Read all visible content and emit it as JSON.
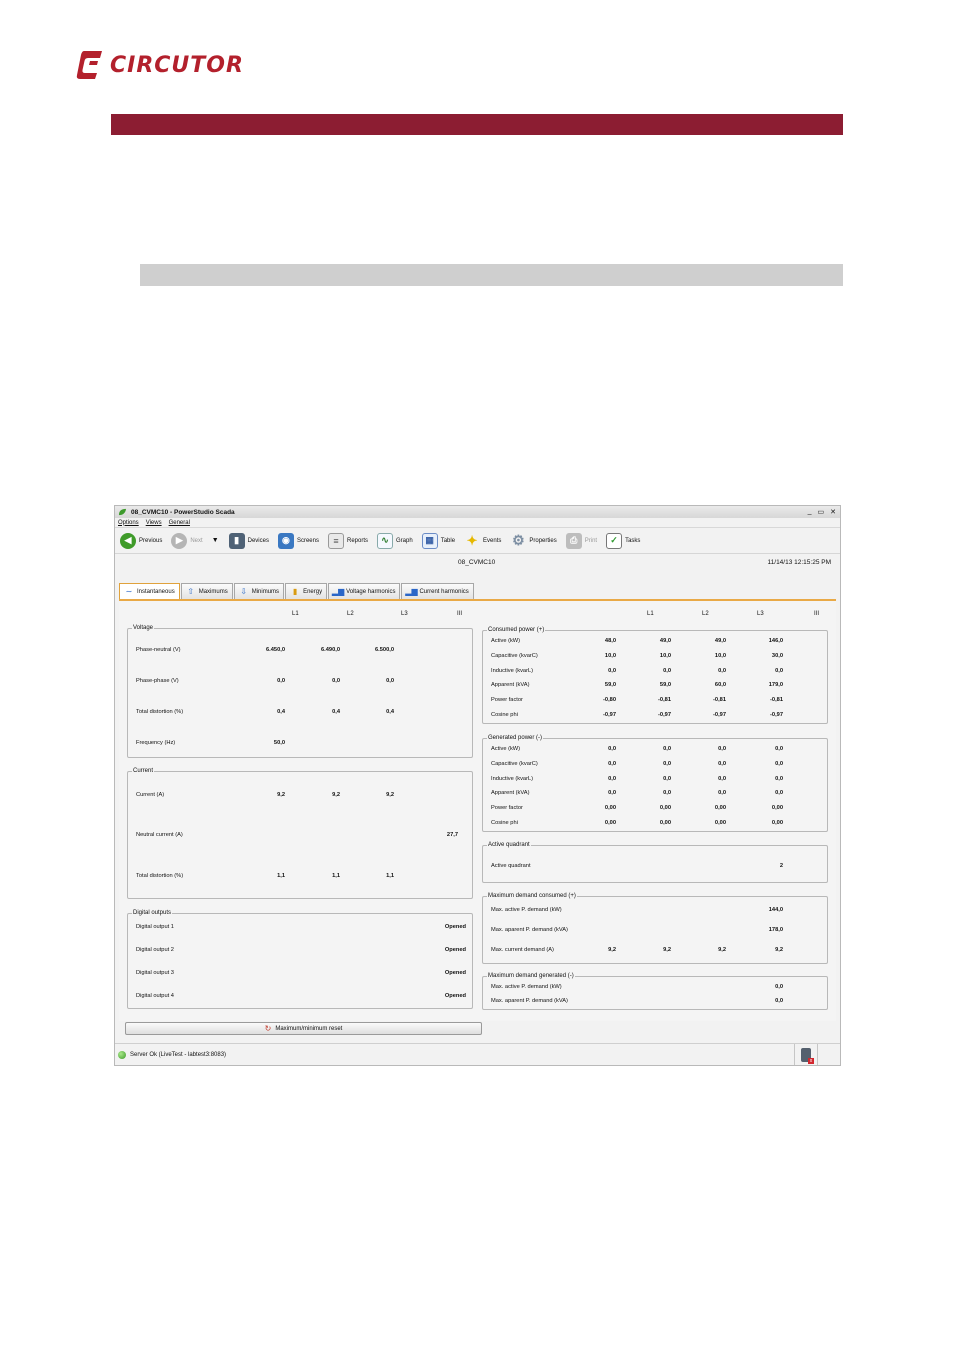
{
  "document": {
    "logo_text": "CIRCUTOR",
    "colors": {
      "brand": "#b3202c",
      "section_bar": "#8c1d32",
      "subsection_bar": "#cfcfcf"
    }
  },
  "window": {
    "title": "08_CVMC10 - PowerStudio Scada",
    "menu": [
      "Options",
      "Views",
      "General"
    ],
    "controls": {
      "minimize": "_",
      "restore": "▭",
      "close": "✕"
    },
    "toolbar": [
      {
        "label": "Previous",
        "icon": "back-arrow-icon",
        "enabled": true
      },
      {
        "label": "Next",
        "icon": "forward-arrow-icon",
        "enabled": false
      },
      {
        "label": "Devices",
        "icon": "device-icon",
        "enabled": true
      },
      {
        "label": "Screens",
        "icon": "screens-icon",
        "enabled": true
      },
      {
        "label": "Reports",
        "icon": "report-icon",
        "enabled": true
      },
      {
        "label": "Graph",
        "icon": "graph-icon",
        "enabled": true
      },
      {
        "label": "Table",
        "icon": "table-icon",
        "enabled": true
      },
      {
        "label": "Events",
        "icon": "events-icon",
        "enabled": true
      },
      {
        "label": "Properties",
        "icon": "gear-icon",
        "enabled": true
      },
      {
        "label": "Print",
        "icon": "printer-icon",
        "enabled": false
      },
      {
        "label": "Tasks",
        "icon": "tasks-icon",
        "enabled": true
      }
    ],
    "device_name": "08_CVMC10",
    "datetime": "11/14/13 12:15:25 PM",
    "tabs": [
      {
        "label": "Instantaneous",
        "icon": "wave-icon",
        "active": true
      },
      {
        "label": "Maximums",
        "icon": "arrow-up-icon",
        "active": false
      },
      {
        "label": "Minimums",
        "icon": "arrow-down-icon",
        "active": false
      },
      {
        "label": "Energy",
        "icon": "battery-icon",
        "active": false
      },
      {
        "label": "Voltage harmonics",
        "icon": "harmonics-icon",
        "active": false
      },
      {
        "label": "Current harmonics",
        "icon": "harmonics-icon",
        "active": false
      }
    ],
    "columns": [
      "L1",
      "L2",
      "L3",
      "III"
    ],
    "voltage": {
      "title": "Voltage",
      "rows": [
        {
          "label": "Phase-neutral (V)",
          "L1": "6.450,0",
          "L2": "6.490,0",
          "L3": "6.500,0",
          "III": ""
        },
        {
          "label": "Phase-phase (V)",
          "L1": "0,0",
          "L2": "0,0",
          "L3": "0,0",
          "III": ""
        },
        {
          "label": "Total distortion (%)",
          "L1": "0,4",
          "L2": "0,4",
          "L3": "0,4",
          "III": ""
        },
        {
          "label": "Frequency (Hz)",
          "L1": "50,0",
          "L2": "",
          "L3": "",
          "III": ""
        }
      ]
    },
    "current": {
      "title": "Current",
      "rows": [
        {
          "label": "Current (A)",
          "L1": "9,2",
          "L2": "9,2",
          "L3": "9,2",
          "III": ""
        },
        {
          "label": "Neutral current (A)",
          "L1": "",
          "L2": "",
          "L3": "",
          "III": "27,7"
        },
        {
          "label": "Total distortion (%)",
          "L1": "1,1",
          "L2": "1,1",
          "L3": "1,1",
          "III": ""
        }
      ]
    },
    "digital_outputs": {
      "title": "Digital outputs",
      "rows": [
        {
          "label": "Digital output 1",
          "state": "Opened"
        },
        {
          "label": "Digital output 2",
          "state": "Opened"
        },
        {
          "label": "Digital output 3",
          "state": "Opened"
        },
        {
          "label": "Digital output 4",
          "state": "Opened"
        }
      ]
    },
    "consumed_power": {
      "title": "Consumed power (+)",
      "rows": [
        {
          "label": "Active (kW)",
          "L1": "48,0",
          "L2": "49,0",
          "L3": "49,0",
          "III": "146,0"
        },
        {
          "label": "Capacitive (kvarC)",
          "L1": "10,0",
          "L2": "10,0",
          "L3": "10,0",
          "III": "30,0"
        },
        {
          "label": "Inductive (kvarL)",
          "L1": "0,0",
          "L2": "0,0",
          "L3": "0,0",
          "III": "0,0"
        },
        {
          "label": "Apparent (kVA)",
          "L1": "59,0",
          "L2": "59,0",
          "L3": "60,0",
          "III": "179,0"
        },
        {
          "label": "Power factor",
          "L1": "-0,80",
          "L2": "-0,81",
          "L3": "-0,81",
          "III": "-0,81"
        },
        {
          "label": "Cosine phi",
          "L1": "-0,97",
          "L2": "-0,97",
          "L3": "-0,97",
          "III": "-0,97"
        }
      ]
    },
    "generated_power": {
      "title": "Generated power (-)",
      "rows": [
        {
          "label": "Active (kW)",
          "L1": "0,0",
          "L2": "0,0",
          "L3": "0,0",
          "III": "0,0"
        },
        {
          "label": "Capacitive (kvarC)",
          "L1": "0,0",
          "L2": "0,0",
          "L3": "0,0",
          "III": "0,0"
        },
        {
          "label": "Inductive (kvarL)",
          "L1": "0,0",
          "L2": "0,0",
          "L3": "0,0",
          "III": "0,0"
        },
        {
          "label": "Apparent (kVA)",
          "L1": "0,0",
          "L2": "0,0",
          "L3": "0,0",
          "III": "0,0"
        },
        {
          "label": "Power factor",
          "L1": "0,00",
          "L2": "0,00",
          "L3": "0,00",
          "III": "0,00"
        },
        {
          "label": "Cosine phi",
          "L1": "0,00",
          "L2": "0,00",
          "L3": "0,00",
          "III": "0,00"
        }
      ]
    },
    "active_quadrant": {
      "title": "Active quadrant",
      "rows": [
        {
          "label": "Active quadrant",
          "L1": "",
          "L2": "",
          "L3": "",
          "III": "2"
        }
      ]
    },
    "max_demand_consumed": {
      "title": "Maximum demand consumed (+)",
      "rows": [
        {
          "label": "Max. active P. demand (kW)",
          "L1": "",
          "L2": "",
          "L3": "",
          "III": "144,0"
        },
        {
          "label": "Max. aparent P. demand (kVA)",
          "L1": "",
          "L2": "",
          "L3": "",
          "III": "178,0"
        },
        {
          "label": "Max. current demand (A)",
          "L1": "9,2",
          "L2": "9,2",
          "L3": "9,2",
          "III": "9,2"
        }
      ]
    },
    "max_demand_generated": {
      "title": "Maximum demand generated (-)",
      "rows": [
        {
          "label": "Max. active P. demand (kW)",
          "L1": "",
          "L2": "",
          "L3": "",
          "III": "0,0"
        },
        {
          "label": "Max. aparent P. demand (kVA)",
          "L1": "",
          "L2": "",
          "L3": "",
          "III": "0,0"
        }
      ]
    },
    "reset_button": "Maximum/minimum reset",
    "status": "Server Ok (LiveTest - labtest3:8083)"
  }
}
